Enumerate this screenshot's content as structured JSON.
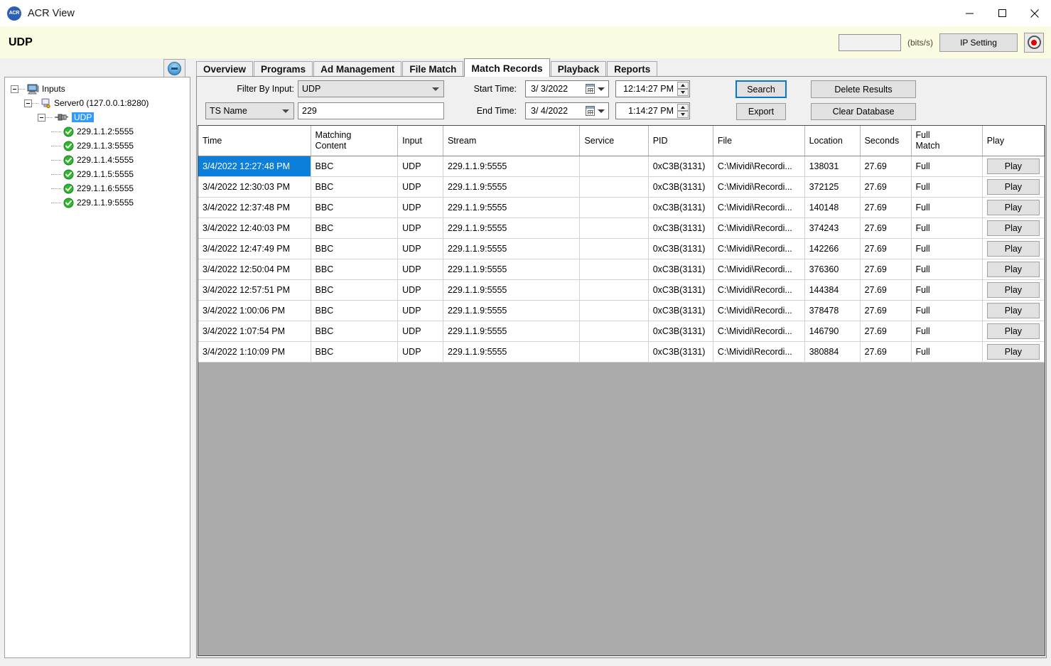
{
  "window": {
    "app_icon_text": "ACR",
    "title": "ACR View",
    "minimize": "—",
    "maximize": "☐",
    "close": "✕"
  },
  "banner": {
    "title": "UDP",
    "bitrate_value": "",
    "bitrate_unit": "(bits/s)",
    "ip_setting_label": "IP Setting",
    "record_tooltip": "record"
  },
  "collapse_button": {
    "label": ""
  },
  "tabs": [
    {
      "label": "Overview",
      "active": false
    },
    {
      "label": "Programs",
      "active": false
    },
    {
      "label": "Ad Management",
      "active": false
    },
    {
      "label": "File Match",
      "active": false
    },
    {
      "label": "Match Records",
      "active": true
    },
    {
      "label": "Playback",
      "active": false
    },
    {
      "label": "Reports",
      "active": false
    }
  ],
  "tree": {
    "root": {
      "label": "Inputs"
    },
    "server": {
      "label": "Server0 (127.0.0.1:8280)"
    },
    "protocol": {
      "label": "UDP",
      "selected": true
    },
    "streams": [
      {
        "label": "229.1.1.2:5555",
        "status": "ok"
      },
      {
        "label": "229.1.1.3:5555",
        "status": "ok"
      },
      {
        "label": "229.1.1.4:5555",
        "status": "ok"
      },
      {
        "label": "229.1.1.5:5555",
        "status": "ok"
      },
      {
        "label": "229.1.1.6:5555",
        "status": "ok"
      },
      {
        "label": "229.1.1.9:5555",
        "status": "ok"
      }
    ]
  },
  "filters": {
    "filter_by_input_label": "Filter By Input:",
    "filter_by_input_value": "UDP",
    "field_selector_value": "TS Name",
    "search_text_value": "229",
    "search_text_placeholder": "",
    "start_time_label": "Start Time:",
    "start_date_value": "3/ 3/2022",
    "start_time_value": "12:14:27 PM",
    "end_time_label": "End Time:",
    "end_date_value": "3/ 4/2022",
    "end_time_value": "1:14:27 PM"
  },
  "actions": {
    "search_label": "Search",
    "export_label": "Export",
    "delete_results_label": "Delete Results",
    "clear_database_label": "Clear Database"
  },
  "grid": {
    "columns": [
      "Time",
      "Matching\nContent",
      "Input",
      "Stream",
      "Service",
      "PID",
      "File",
      "Location",
      "Seconds",
      "Full\nMatch",
      "Play"
    ],
    "play_label": "Play",
    "rows": [
      {
        "selected": true,
        "time": "3/4/2022 12:27:48 PM",
        "content": "BBC",
        "input": "UDP",
        "stream": "229.1.1.9:5555",
        "service": "",
        "pid": "0xC3B(3131)",
        "file": "C:\\Mividi\\Recordi...",
        "location": "138031",
        "seconds": "27.69",
        "full_match": "Full",
        "play": "Play"
      },
      {
        "selected": false,
        "time": "3/4/2022 12:30:03 PM",
        "content": "BBC",
        "input": "UDP",
        "stream": "229.1.1.9:5555",
        "service": "",
        "pid": "0xC3B(3131)",
        "file": "C:\\Mividi\\Recordi...",
        "location": "372125",
        "seconds": "27.69",
        "full_match": "Full",
        "play": "Play"
      },
      {
        "selected": false,
        "time": "3/4/2022 12:37:48 PM",
        "content": "BBC",
        "input": "UDP",
        "stream": "229.1.1.9:5555",
        "service": "",
        "pid": "0xC3B(3131)",
        "file": "C:\\Mividi\\Recordi...",
        "location": "140148",
        "seconds": "27.69",
        "full_match": "Full",
        "play": "Play"
      },
      {
        "selected": false,
        "time": "3/4/2022 12:40:03 PM",
        "content": "BBC",
        "input": "UDP",
        "stream": "229.1.1.9:5555",
        "service": "",
        "pid": "0xC3B(3131)",
        "file": "C:\\Mividi\\Recordi...",
        "location": "374243",
        "seconds": "27.69",
        "full_match": "Full",
        "play": "Play"
      },
      {
        "selected": false,
        "time": "3/4/2022 12:47:49 PM",
        "content": "BBC",
        "input": "UDP",
        "stream": "229.1.1.9:5555",
        "service": "",
        "pid": "0xC3B(3131)",
        "file": "C:\\Mividi\\Recordi...",
        "location": "142266",
        "seconds": "27.69",
        "full_match": "Full",
        "play": "Play"
      },
      {
        "selected": false,
        "time": "3/4/2022 12:50:04 PM",
        "content": "BBC",
        "input": "UDP",
        "stream": "229.1.1.9:5555",
        "service": "",
        "pid": "0xC3B(3131)",
        "file": "C:\\Mividi\\Recordi...",
        "location": "376360",
        "seconds": "27.69",
        "full_match": "Full",
        "play": "Play"
      },
      {
        "selected": false,
        "time": "3/4/2022 12:57:51 PM",
        "content": "BBC",
        "input": "UDP",
        "stream": "229.1.1.9:5555",
        "service": "",
        "pid": "0xC3B(3131)",
        "file": "C:\\Mividi\\Recordi...",
        "location": "144384",
        "seconds": "27.69",
        "full_match": "Full",
        "play": "Play"
      },
      {
        "selected": false,
        "time": "3/4/2022 1:00:06 PM",
        "content": "BBC",
        "input": "UDP",
        "stream": "229.1.1.9:5555",
        "service": "",
        "pid": "0xC3B(3131)",
        "file": "C:\\Mividi\\Recordi...",
        "location": "378478",
        "seconds": "27.69",
        "full_match": "Full",
        "play": "Play"
      },
      {
        "selected": false,
        "time": "3/4/2022 1:07:54 PM",
        "content": "BBC",
        "input": "UDP",
        "stream": "229.1.1.9:5555",
        "service": "",
        "pid": "0xC3B(3131)",
        "file": "C:\\Mividi\\Recordi...",
        "location": "146790",
        "seconds": "27.69",
        "full_match": "Full",
        "play": "Play"
      },
      {
        "selected": false,
        "time": "3/4/2022 1:10:09 PM",
        "content": "BBC",
        "input": "UDP",
        "stream": "229.1.1.9:5555",
        "service": "",
        "pid": "0xC3B(3131)",
        "file": "C:\\Mividi\\Recordi...",
        "location": "380884",
        "seconds": "27.69",
        "full_match": "Full",
        "play": "Play"
      }
    ]
  },
  "colors": {
    "banner_background": "#fbfbe2",
    "selection_blue": "#0c7fdb",
    "grid_empty_background": "#ababab",
    "panel_background": "#f0f0f0",
    "status_ok_green": "#2eb82e",
    "record_red": "#e00000"
  }
}
